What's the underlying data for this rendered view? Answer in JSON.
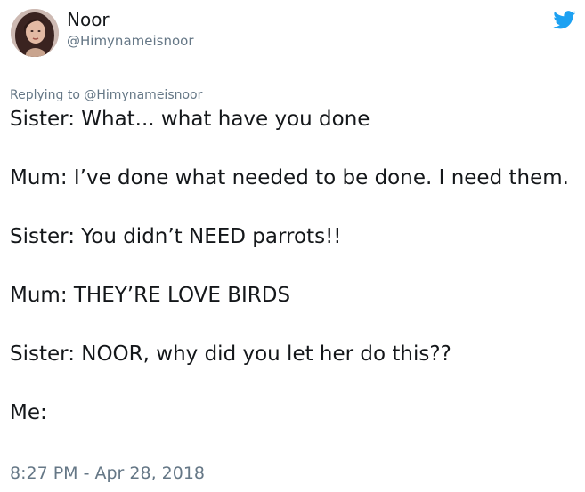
{
  "author": {
    "name": "Noor",
    "handle": "@Himynameisnoor"
  },
  "reply": {
    "prefix": "Replying to ",
    "mention": "@Himynameisnoor"
  },
  "tweet": {
    "lines": [
      "Sister: What... what have you done",
      "Mum: I’ve done what needed to be done. I need them.",
      "Sister: You didn’t NEED parrots!!",
      "Mum: THEY’RE LOVE BIRDS",
      "Sister: NOOR, why did you let her do this??",
      "Me:"
    ],
    "timestamp": "8:27 PM - Apr 28, 2018"
  },
  "icons": {
    "brand": "twitter-bird-icon",
    "avatar": "profile-photo"
  },
  "colors": {
    "brand": "#1da1f2",
    "secondary_text": "#657786",
    "primary_text": "#14171a"
  }
}
